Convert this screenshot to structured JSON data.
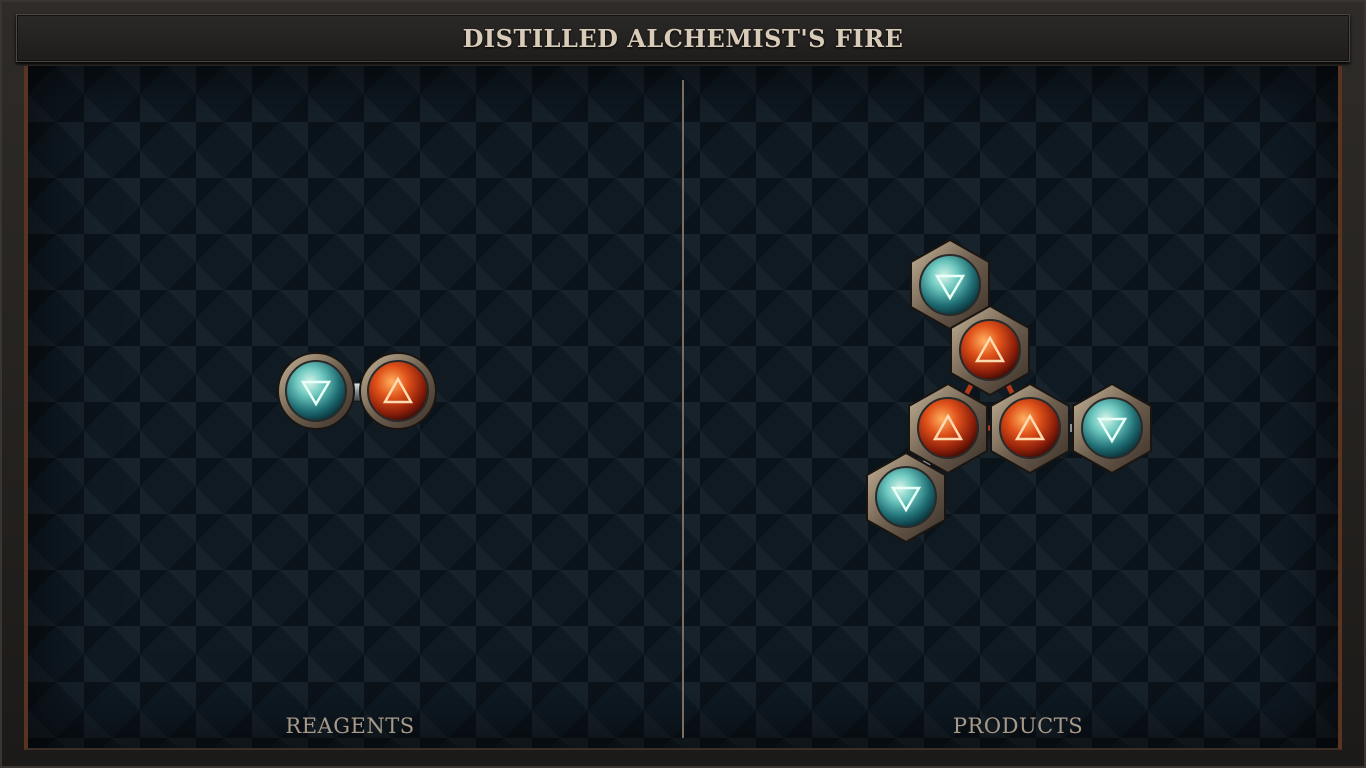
{
  "title": "DISTILLED ALCHEMIST'S FIRE",
  "panels": {
    "reagents_label": "REAGENTS",
    "products_label": "PRODUCTS"
  },
  "colors": {
    "water_orb": "#3fa9a6",
    "fire_orb": "#d44a12",
    "frame_metal": "#8c7a64",
    "background": "#0f1a23"
  },
  "elements": {
    "water_symbol": "▽",
    "fire_symbol": "△"
  }
}
